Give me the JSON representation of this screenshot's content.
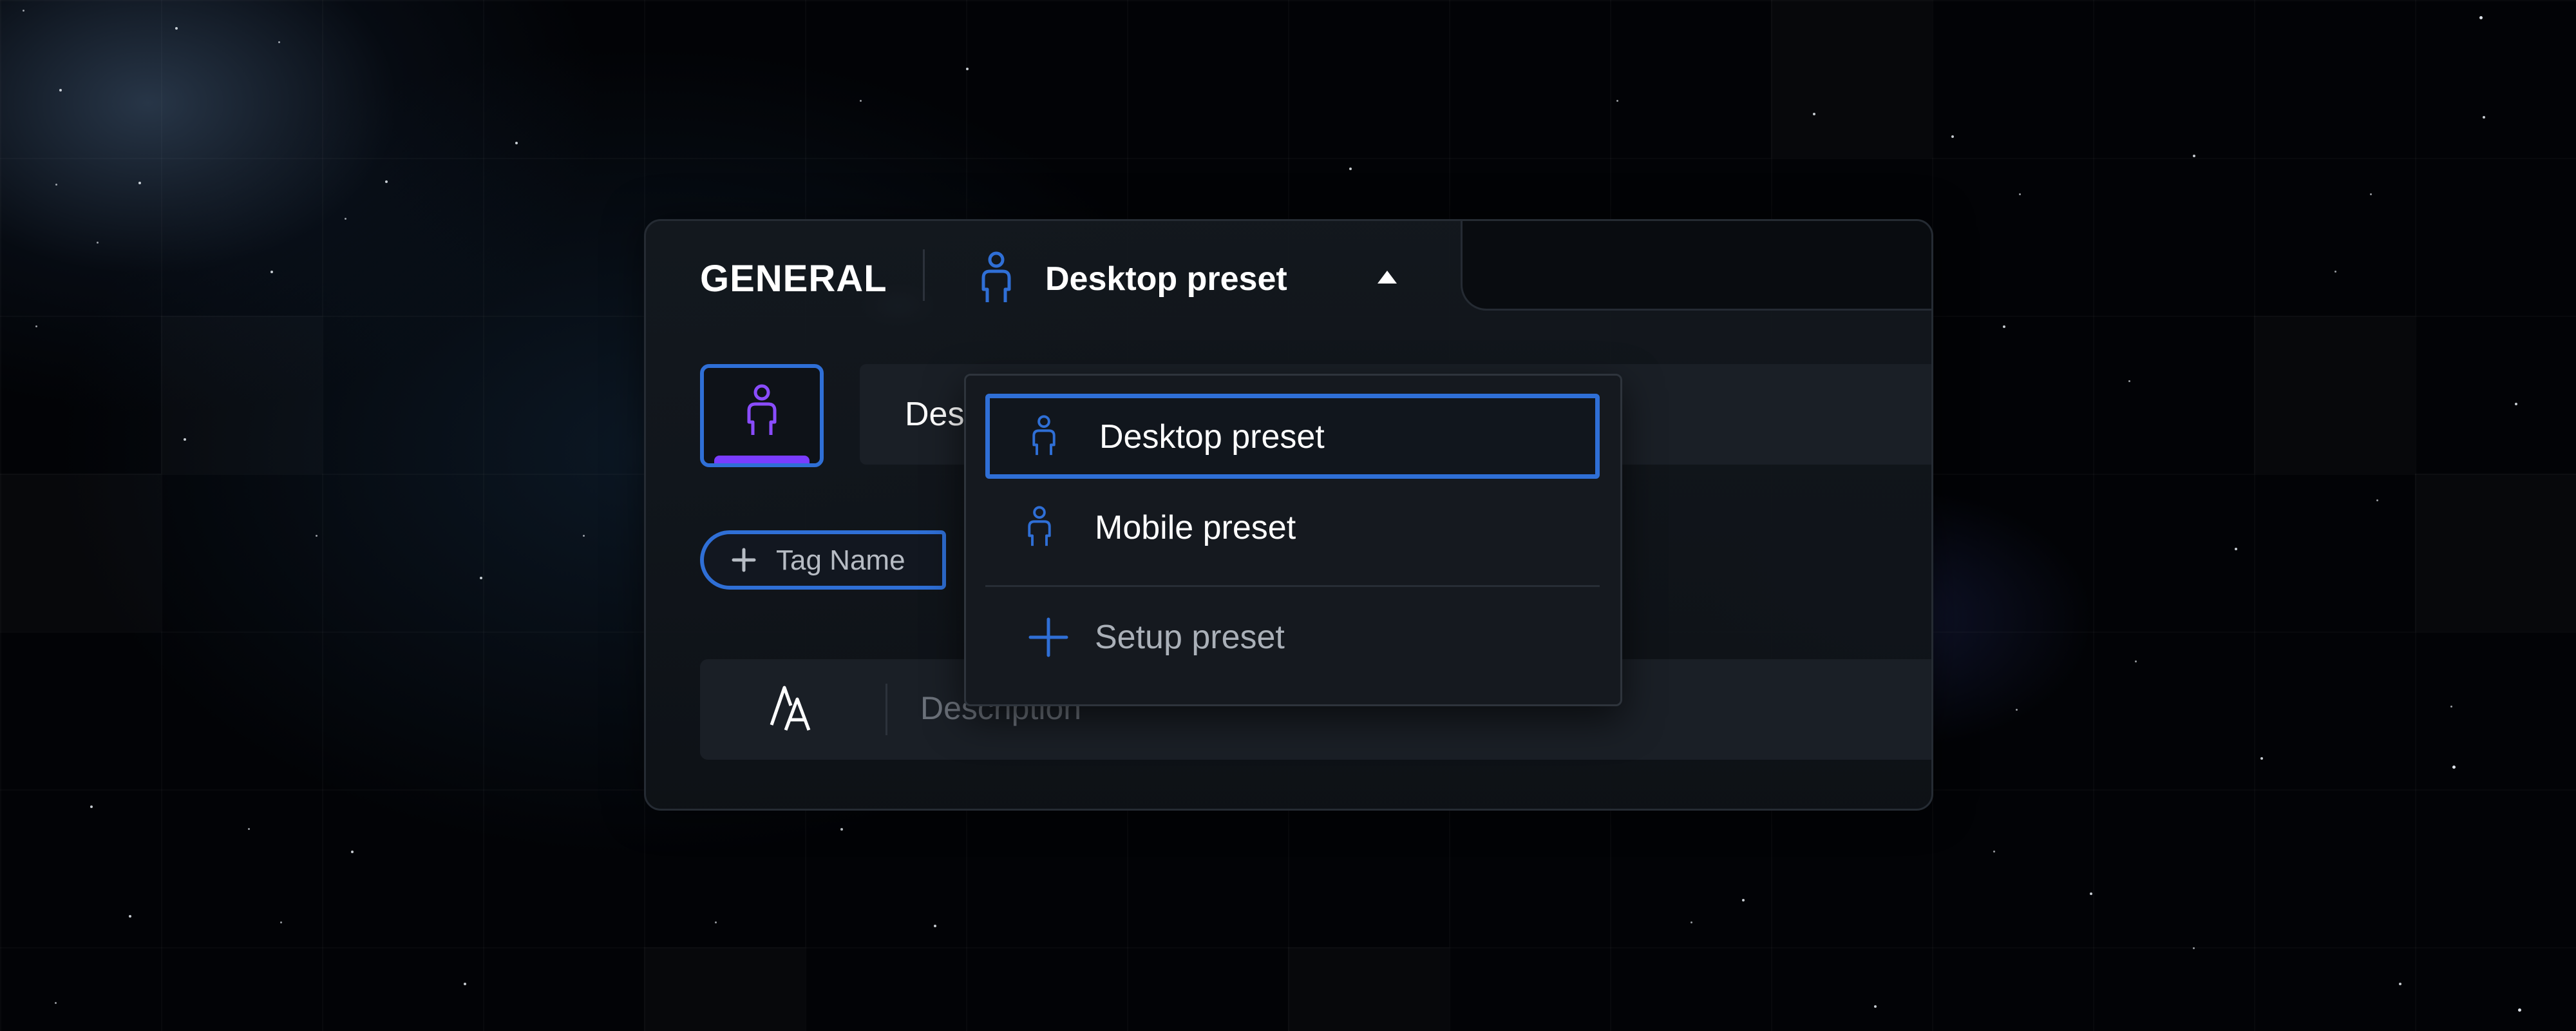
{
  "tabbar": {
    "section_title": "GENERAL",
    "selected_preset": "Desktop preset"
  },
  "profile": {
    "name_value": "Desktop preset"
  },
  "tag": {
    "label": "Tag Name"
  },
  "description": {
    "placeholder": "Description"
  },
  "dropdown": {
    "items": [
      {
        "label": "Desktop preset",
        "icon": "person-icon",
        "selected": true
      },
      {
        "label": "Mobile preset",
        "icon": "person-icon",
        "selected": false
      }
    ],
    "add_item": {
      "label": "Setup preset",
      "icon": "plus-icon"
    }
  },
  "colors": {
    "accent": "#2f6fd6",
    "avatar_bar": "#7a3cff",
    "background": "#020306",
    "card": "#14191f"
  }
}
